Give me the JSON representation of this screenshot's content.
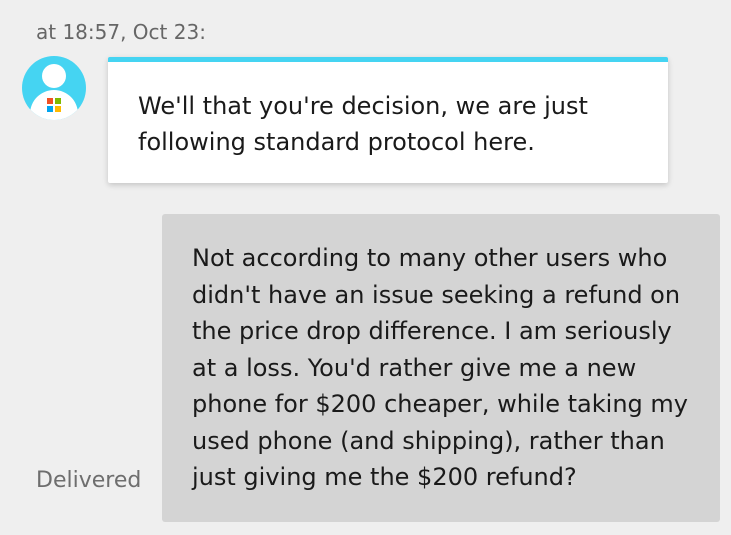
{
  "conversation": {
    "timestamp": "at 18:57, Oct 23:",
    "agent_message": {
      "avatar_icon": "user-avatar-icon",
      "badge_icon": "microsoft-logo-icon",
      "accent_color": "#45d4f2",
      "text": "We'll that you're decision, we are just following standard protocol here."
    },
    "user_message": {
      "text": "Not according to many other users who didn't have an issue seeking a refund on the price drop difference. I am seriously at a loss. You'd rather give me a new phone for $200 cheaper, while taking my used phone (and shipping), rather than just giving me the $200 refund?",
      "status": "Delivered"
    }
  }
}
